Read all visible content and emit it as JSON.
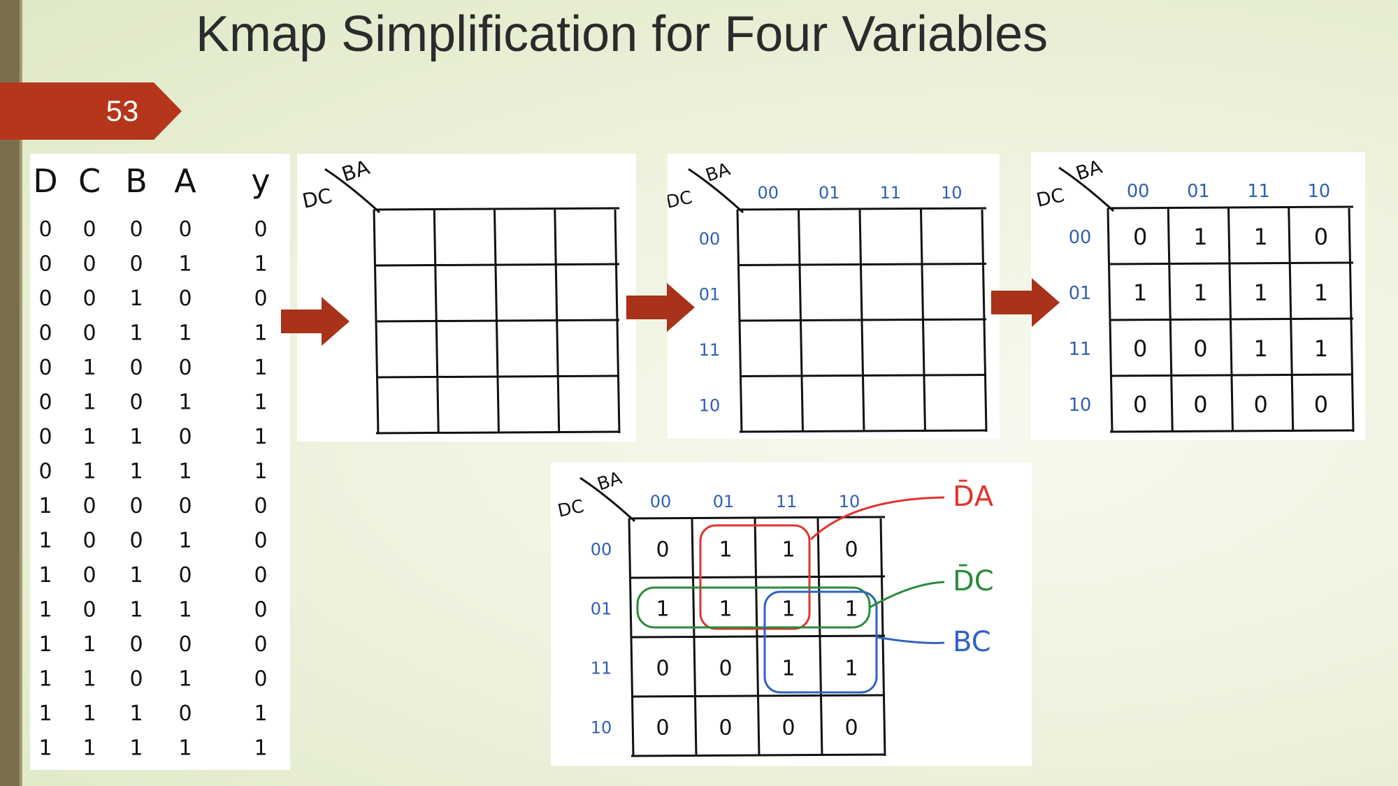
{
  "slide": {
    "title": "Kmap Simplification for Four Variables",
    "page_number": "53"
  },
  "truth_table": {
    "headers": [
      "D",
      "C",
      "B",
      "A",
      "y"
    ],
    "rows": [
      [
        "0",
        "0",
        "0",
        "0",
        "0"
      ],
      [
        "0",
        "0",
        "0",
        "1",
        "1"
      ],
      [
        "0",
        "0",
        "1",
        "0",
        "0"
      ],
      [
        "0",
        "0",
        "1",
        "1",
        "1"
      ],
      [
        "0",
        "1",
        "0",
        "0",
        "1"
      ],
      [
        "0",
        "1",
        "0",
        "1",
        "1"
      ],
      [
        "0",
        "1",
        "1",
        "0",
        "1"
      ],
      [
        "0",
        "1",
        "1",
        "1",
        "1"
      ],
      [
        "1",
        "0",
        "0",
        "0",
        "0"
      ],
      [
        "1",
        "0",
        "0",
        "1",
        "0"
      ],
      [
        "1",
        "0",
        "1",
        "0",
        "0"
      ],
      [
        "1",
        "0",
        "1",
        "1",
        "0"
      ],
      [
        "1",
        "1",
        "0",
        "0",
        "0"
      ],
      [
        "1",
        "1",
        "0",
        "1",
        "0"
      ],
      [
        "1",
        "1",
        "1",
        "0",
        "1"
      ],
      [
        "1",
        "1",
        "1",
        "1",
        "1"
      ]
    ]
  },
  "kmap": {
    "row_var": "DC",
    "col_var": "BA",
    "col_labels": [
      "00",
      "01",
      "11",
      "10"
    ],
    "row_labels": [
      "00",
      "01",
      "11",
      "10"
    ],
    "values": [
      [
        "0",
        "1",
        "1",
        "0"
      ],
      [
        "1",
        "1",
        "1",
        "1"
      ],
      [
        "0",
        "0",
        "1",
        "1"
      ],
      [
        "0",
        "0",
        "0",
        "0"
      ]
    ]
  },
  "groups": [
    {
      "label": "D̄A",
      "color": "#e0342c"
    },
    {
      "label": "D̄C",
      "color": "#2c8a3a"
    },
    {
      "label": "BC",
      "color": "#2f62c4"
    }
  ],
  "colors": {
    "accent": "#b5361b",
    "arrow": "#a8321a"
  }
}
